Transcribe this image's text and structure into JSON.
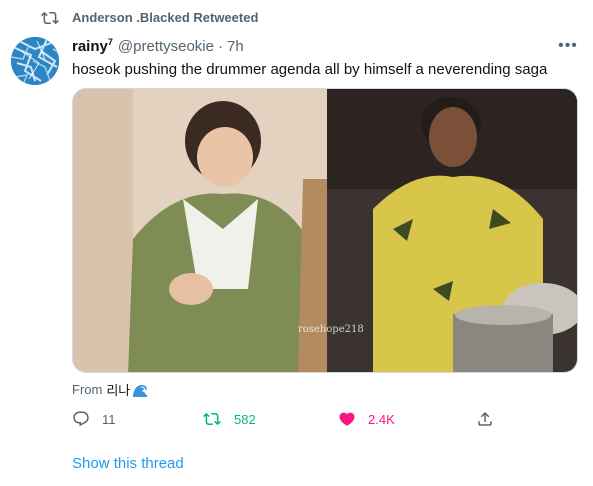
{
  "retweet": {
    "icon": "retweet-icon",
    "text": "Anderson .Blacked Retweeted"
  },
  "tweet": {
    "author_name": "rainy",
    "author_sup": "7",
    "handle": "@prettyseokie",
    "separator": "·",
    "time": "7h",
    "more_icon": "more-horizontal-icon",
    "more_label": "•••",
    "text": "hoseok pushing the drummer agenda all by himself a neverending saga",
    "media_watermark": "rosehope218",
    "from_label": "From",
    "from_app": "리나",
    "from_emoji_icon": "wave-icon"
  },
  "actions": {
    "reply": {
      "icon": "reply-icon",
      "count": "11"
    },
    "retweet": {
      "icon": "retweet-icon",
      "count": "582"
    },
    "like": {
      "icon": "heart-filled-icon",
      "count": "2.4K"
    },
    "share": {
      "icon": "share-icon"
    }
  },
  "show_thread": "Show this thread",
  "colors": {
    "secondary_text": "#536471",
    "primary_text": "#0f1419",
    "link": "#1d9bf0",
    "retweet_green": "#00ba7c",
    "like_pink": "#f91880",
    "border": "#cfd9de"
  }
}
